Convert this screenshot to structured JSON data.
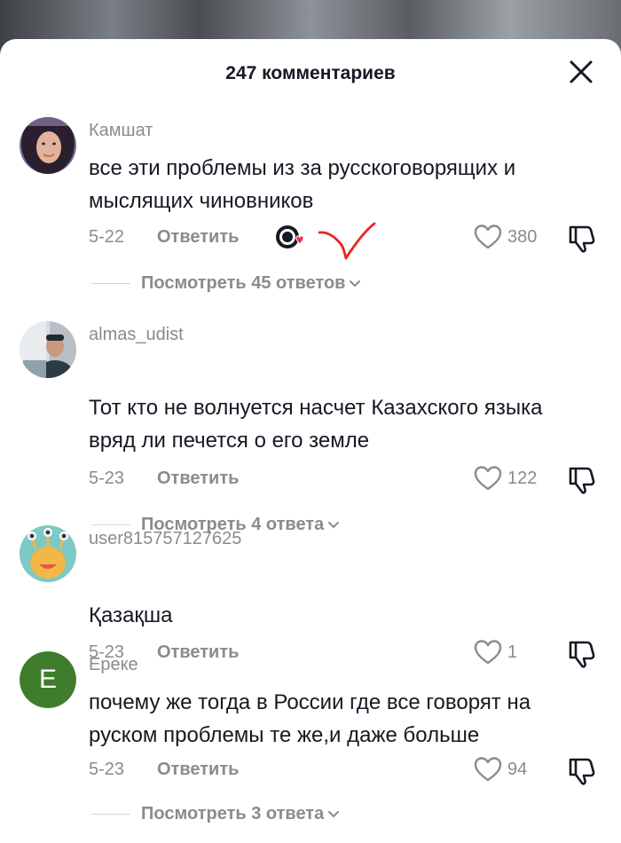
{
  "header": {
    "title": "247 комментариев"
  },
  "comments": [
    {
      "username": "Камшат",
      "text": "все эти проблемы из за русскоговорящих и мыслящих чиновников",
      "date": "5-22",
      "reply_label": "Ответить",
      "likes": "380",
      "view_replies": "Посмотреть 45 ответов",
      "avatar_icon": "user-photo"
    },
    {
      "username": "almas_udist",
      "text": "Тот кто не волнуется насчет Казахского языка вряд ли печется о его земле",
      "date": "5-23",
      "reply_label": "Ответить",
      "likes": "122",
      "view_replies": "Посмотреть 4 ответа",
      "avatar_icon": "user-photo"
    },
    {
      "username": "user815757127625",
      "text": "Қазақша",
      "date": "5-23",
      "reply_label": "Ответить",
      "likes": "1",
      "avatar_icon": "monster-avatar"
    },
    {
      "username": "Ереке",
      "text": "почему же тогда в России где все говорят на руском проблемы те же,и даже больше",
      "date": "5-23",
      "reply_label": "Ответить",
      "likes": "94",
      "view_replies": "Посмотреть 3 ответа",
      "avatar_letter": "E",
      "avatar_color": "#3f7d2c"
    }
  ],
  "colors": {
    "accent_red": "#fe2c55",
    "annotation_red": "#e8261f",
    "text_primary": "#161823",
    "text_secondary": "#8a8b91"
  }
}
